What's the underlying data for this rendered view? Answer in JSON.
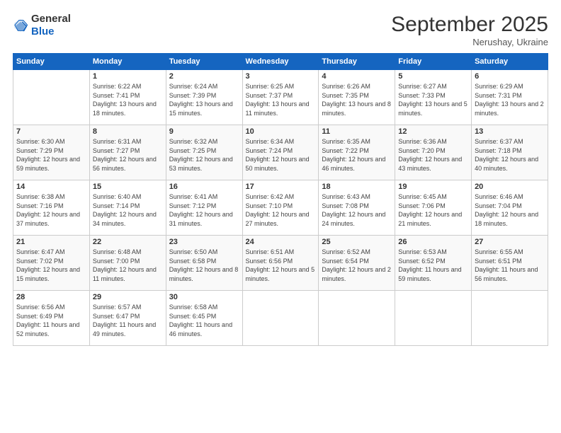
{
  "header": {
    "logo_line1": "General",
    "logo_line2": "Blue",
    "month_title": "September 2025",
    "subtitle": "Nerushay, Ukraine"
  },
  "days_of_week": [
    "Sunday",
    "Monday",
    "Tuesday",
    "Wednesday",
    "Thursday",
    "Friday",
    "Saturday"
  ],
  "weeks": [
    [
      {
        "day": "",
        "sunrise": "",
        "sunset": "",
        "daylight": ""
      },
      {
        "day": "1",
        "sunrise": "Sunrise: 6:22 AM",
        "sunset": "Sunset: 7:41 PM",
        "daylight": "Daylight: 13 hours and 18 minutes."
      },
      {
        "day": "2",
        "sunrise": "Sunrise: 6:24 AM",
        "sunset": "Sunset: 7:39 PM",
        "daylight": "Daylight: 13 hours and 15 minutes."
      },
      {
        "day": "3",
        "sunrise": "Sunrise: 6:25 AM",
        "sunset": "Sunset: 7:37 PM",
        "daylight": "Daylight: 13 hours and 11 minutes."
      },
      {
        "day": "4",
        "sunrise": "Sunrise: 6:26 AM",
        "sunset": "Sunset: 7:35 PM",
        "daylight": "Daylight: 13 hours and 8 minutes."
      },
      {
        "day": "5",
        "sunrise": "Sunrise: 6:27 AM",
        "sunset": "Sunset: 7:33 PM",
        "daylight": "Daylight: 13 hours and 5 minutes."
      },
      {
        "day": "6",
        "sunrise": "Sunrise: 6:29 AM",
        "sunset": "Sunset: 7:31 PM",
        "daylight": "Daylight: 13 hours and 2 minutes."
      }
    ],
    [
      {
        "day": "7",
        "sunrise": "Sunrise: 6:30 AM",
        "sunset": "Sunset: 7:29 PM",
        "daylight": "Daylight: 12 hours and 59 minutes."
      },
      {
        "day": "8",
        "sunrise": "Sunrise: 6:31 AM",
        "sunset": "Sunset: 7:27 PM",
        "daylight": "Daylight: 12 hours and 56 minutes."
      },
      {
        "day": "9",
        "sunrise": "Sunrise: 6:32 AM",
        "sunset": "Sunset: 7:25 PM",
        "daylight": "Daylight: 12 hours and 53 minutes."
      },
      {
        "day": "10",
        "sunrise": "Sunrise: 6:34 AM",
        "sunset": "Sunset: 7:24 PM",
        "daylight": "Daylight: 12 hours and 50 minutes."
      },
      {
        "day": "11",
        "sunrise": "Sunrise: 6:35 AM",
        "sunset": "Sunset: 7:22 PM",
        "daylight": "Daylight: 12 hours and 46 minutes."
      },
      {
        "day": "12",
        "sunrise": "Sunrise: 6:36 AM",
        "sunset": "Sunset: 7:20 PM",
        "daylight": "Daylight: 12 hours and 43 minutes."
      },
      {
        "day": "13",
        "sunrise": "Sunrise: 6:37 AM",
        "sunset": "Sunset: 7:18 PM",
        "daylight": "Daylight: 12 hours and 40 minutes."
      }
    ],
    [
      {
        "day": "14",
        "sunrise": "Sunrise: 6:38 AM",
        "sunset": "Sunset: 7:16 PM",
        "daylight": "Daylight: 12 hours and 37 minutes."
      },
      {
        "day": "15",
        "sunrise": "Sunrise: 6:40 AM",
        "sunset": "Sunset: 7:14 PM",
        "daylight": "Daylight: 12 hours and 34 minutes."
      },
      {
        "day": "16",
        "sunrise": "Sunrise: 6:41 AM",
        "sunset": "Sunset: 7:12 PM",
        "daylight": "Daylight: 12 hours and 31 minutes."
      },
      {
        "day": "17",
        "sunrise": "Sunrise: 6:42 AM",
        "sunset": "Sunset: 7:10 PM",
        "daylight": "Daylight: 12 hours and 27 minutes."
      },
      {
        "day": "18",
        "sunrise": "Sunrise: 6:43 AM",
        "sunset": "Sunset: 7:08 PM",
        "daylight": "Daylight: 12 hours and 24 minutes."
      },
      {
        "day": "19",
        "sunrise": "Sunrise: 6:45 AM",
        "sunset": "Sunset: 7:06 PM",
        "daylight": "Daylight: 12 hours and 21 minutes."
      },
      {
        "day": "20",
        "sunrise": "Sunrise: 6:46 AM",
        "sunset": "Sunset: 7:04 PM",
        "daylight": "Daylight: 12 hours and 18 minutes."
      }
    ],
    [
      {
        "day": "21",
        "sunrise": "Sunrise: 6:47 AM",
        "sunset": "Sunset: 7:02 PM",
        "daylight": "Daylight: 12 hours and 15 minutes."
      },
      {
        "day": "22",
        "sunrise": "Sunrise: 6:48 AM",
        "sunset": "Sunset: 7:00 PM",
        "daylight": "Daylight: 12 hours and 11 minutes."
      },
      {
        "day": "23",
        "sunrise": "Sunrise: 6:50 AM",
        "sunset": "Sunset: 6:58 PM",
        "daylight": "Daylight: 12 hours and 8 minutes."
      },
      {
        "day": "24",
        "sunrise": "Sunrise: 6:51 AM",
        "sunset": "Sunset: 6:56 PM",
        "daylight": "Daylight: 12 hours and 5 minutes."
      },
      {
        "day": "25",
        "sunrise": "Sunrise: 6:52 AM",
        "sunset": "Sunset: 6:54 PM",
        "daylight": "Daylight: 12 hours and 2 minutes."
      },
      {
        "day": "26",
        "sunrise": "Sunrise: 6:53 AM",
        "sunset": "Sunset: 6:52 PM",
        "daylight": "Daylight: 11 hours and 59 minutes."
      },
      {
        "day": "27",
        "sunrise": "Sunrise: 6:55 AM",
        "sunset": "Sunset: 6:51 PM",
        "daylight": "Daylight: 11 hours and 56 minutes."
      }
    ],
    [
      {
        "day": "28",
        "sunrise": "Sunrise: 6:56 AM",
        "sunset": "Sunset: 6:49 PM",
        "daylight": "Daylight: 11 hours and 52 minutes."
      },
      {
        "day": "29",
        "sunrise": "Sunrise: 6:57 AM",
        "sunset": "Sunset: 6:47 PM",
        "daylight": "Daylight: 11 hours and 49 minutes."
      },
      {
        "day": "30",
        "sunrise": "Sunrise: 6:58 AM",
        "sunset": "Sunset: 6:45 PM",
        "daylight": "Daylight: 11 hours and 46 minutes."
      },
      {
        "day": "",
        "sunrise": "",
        "sunset": "",
        "daylight": ""
      },
      {
        "day": "",
        "sunrise": "",
        "sunset": "",
        "daylight": ""
      },
      {
        "day": "",
        "sunrise": "",
        "sunset": "",
        "daylight": ""
      },
      {
        "day": "",
        "sunrise": "",
        "sunset": "",
        "daylight": ""
      }
    ]
  ]
}
